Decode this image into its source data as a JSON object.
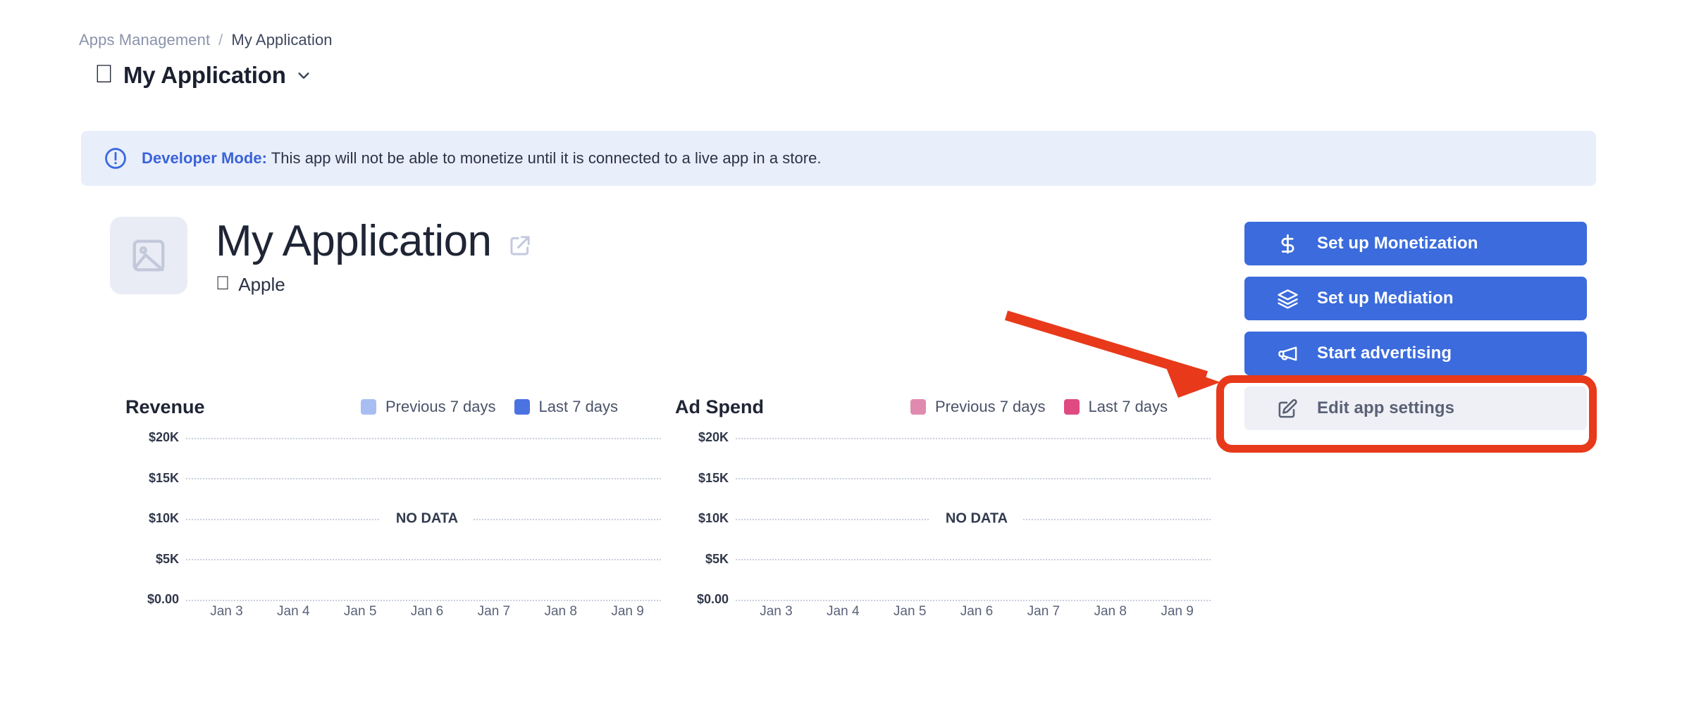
{
  "breadcrumb": {
    "parent": "Apps Management",
    "separator": "/",
    "current": "My Application"
  },
  "app_switcher": {
    "platform_icon": "apple-icon",
    "name": "My Application",
    "chevron_icon": "chevron-down-icon"
  },
  "banner": {
    "icon": "alert-circle-icon",
    "emphasis": "Developer Mode:",
    "message": " This app will not be able to monetize until it is connected to a live app in a store.",
    "background_color": "#e9eefb",
    "accent_color": "#3a63d8"
  },
  "hero": {
    "thumbnail_icon": "image-placeholder-icon",
    "title": "My Application",
    "external_link_icon": "external-link-icon",
    "platform_icon": "apple-icon",
    "platform_label": "Apple"
  },
  "actions": [
    {
      "label": "Set up Monetization",
      "icon": "dollar-icon",
      "style": "primary",
      "color": "#3b6bdc"
    },
    {
      "label": "Set up Mediation",
      "icon": "layers-icon",
      "style": "primary",
      "color": "#3b6bdc"
    },
    {
      "label": "Start advertising",
      "icon": "megaphone-icon",
      "style": "primary",
      "color": "#3b6bdc"
    },
    {
      "label": "Edit app settings",
      "icon": "edit-square-icon",
      "style": "secondary",
      "color": "#eef0f6"
    }
  ],
  "annotation": {
    "highlight_target": "Edit app settings",
    "highlight_color": "#e8391b",
    "arrow_color": "#e8391b"
  },
  "chart_data": [
    {
      "type": "bar",
      "title": "Revenue",
      "xlabel": "",
      "ylabel": "",
      "empty_state": "NO DATA",
      "categories": [
        "Jan 3",
        "Jan 4",
        "Jan 5",
        "Jan 6",
        "Jan 7",
        "Jan 8",
        "Jan 9"
      ],
      "ytick_labels": [
        "$20K",
        "$15K",
        "$10K",
        "$5K",
        "$0.00"
      ],
      "ytick_values": [
        20000,
        15000,
        10000,
        5000,
        0
      ],
      "ylim": [
        0,
        20000
      ],
      "grid": true,
      "legend_position": "top-right",
      "series": [
        {
          "name": "Previous 7 days",
          "color": "#a8bdf2",
          "values": [
            0,
            0,
            0,
            0,
            0,
            0,
            0
          ]
        },
        {
          "name": "Last 7 days",
          "color": "#4a72e0",
          "values": [
            0,
            0,
            0,
            0,
            0,
            0,
            0
          ]
        }
      ]
    },
    {
      "type": "bar",
      "title": "Ad Spend",
      "xlabel": "",
      "ylabel": "",
      "empty_state": "NO DATA",
      "categories": [
        "Jan 3",
        "Jan 4",
        "Jan 5",
        "Jan 6",
        "Jan 7",
        "Jan 8",
        "Jan 9"
      ],
      "ytick_labels": [
        "$20K",
        "$15K",
        "$10K",
        "$5K",
        "$0.00"
      ],
      "ytick_values": [
        20000,
        15000,
        10000,
        5000,
        0
      ],
      "ylim": [
        0,
        20000
      ],
      "grid": true,
      "legend_position": "top-right",
      "series": [
        {
          "name": "Previous 7 days",
          "color": "#e08ab0",
          "values": [
            0,
            0,
            0,
            0,
            0,
            0,
            0
          ]
        },
        {
          "name": "Last 7 days",
          "color": "#e04a82",
          "values": [
            0,
            0,
            0,
            0,
            0,
            0,
            0
          ]
        }
      ]
    }
  ]
}
